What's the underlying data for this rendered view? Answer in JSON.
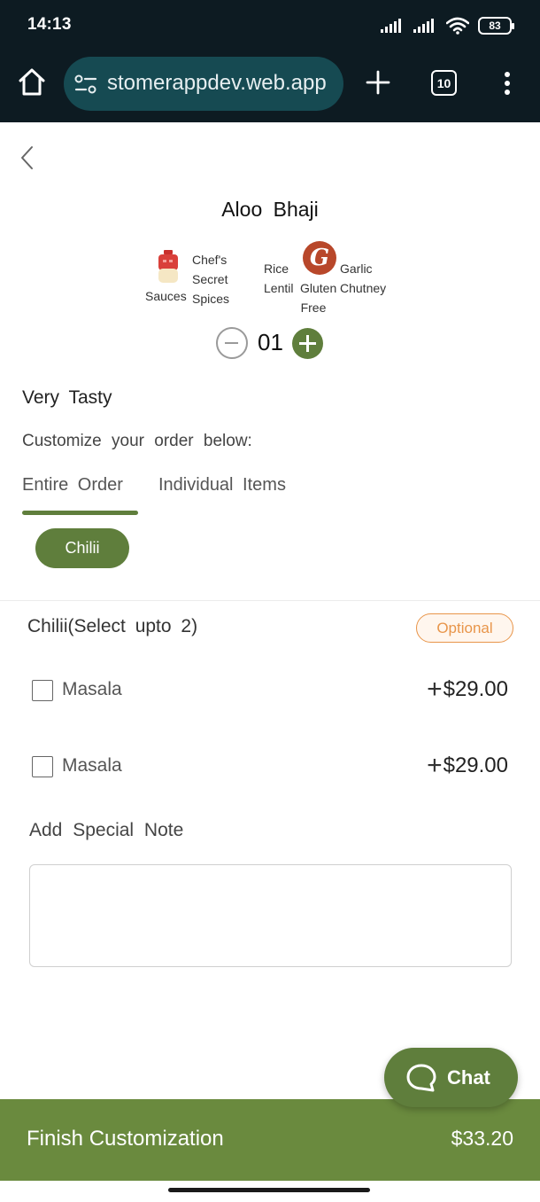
{
  "status_bar": {
    "time": "14:13",
    "battery": "83",
    "icons": [
      "signal-icon",
      "signal-icon",
      "wifi-icon",
      "battery-icon"
    ]
  },
  "browser": {
    "url": "stomerappdev.web.app",
    "tab_count": "10",
    "icons": [
      "home-icon",
      "site-settings-icon",
      "new-tab-plus-icon",
      "tab-switcher-icon",
      "more-menu-icon"
    ]
  },
  "item": {
    "title": "Aloo  Bhaji",
    "tags": {
      "sauces": "Sauces",
      "chefs_secret_spices": [
        "Chef's",
        "Secret",
        "Spices"
      ],
      "rice_lentil": [
        "Rice",
        "Lentil"
      ],
      "gluten_free": [
        "Gluten",
        "Free"
      ],
      "garlic_chutney": [
        "Garlic",
        "Chutney"
      ],
      "logo_letter": "G"
    },
    "quantity": "01",
    "description": "Very  Tasty"
  },
  "customize": {
    "label": "Customize  your  order  below:",
    "tabs": [
      {
        "label": "Entire  Order",
        "active": true
      },
      {
        "label": "Individual  Items",
        "active": false
      }
    ],
    "chips": [
      "Chilii"
    ]
  },
  "group": {
    "title": "Chilii(Select  upto  2)",
    "badge": "Optional",
    "options": [
      {
        "label": "Masala",
        "price": "$29.00",
        "checked": false
      },
      {
        "label": "Masala",
        "price": "$29.00",
        "checked": false
      }
    ]
  },
  "note": {
    "label": "Add  Special  Note",
    "value": ""
  },
  "chat": {
    "label": "Chat"
  },
  "footer": {
    "label": "Finish Customization",
    "total": "$33.20"
  },
  "colors": {
    "brand_green": "#5f7e3c",
    "footer_green": "#6a8a3e",
    "optional_orange": "#e8954a",
    "browser_bg": "#0d1b22",
    "url_bg": "#164a52"
  }
}
